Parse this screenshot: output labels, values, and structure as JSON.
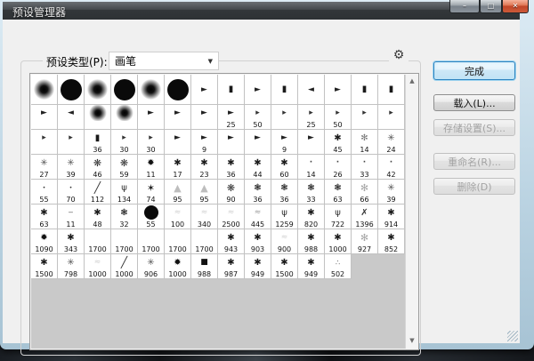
{
  "window": {
    "title": "预设管理器",
    "minimize_glyph": "–",
    "restore_glyph": "□",
    "close_glyph": "✕"
  },
  "toolbar": {
    "preset_type_label": "预设类型(P):",
    "preset_type_value": "画笔",
    "combo_arrow": "▼",
    "gear_icon": "⚙"
  },
  "scrollbar": {
    "up": "▲",
    "down": "▼"
  },
  "actions": [
    {
      "label": "完成",
      "enabled": true,
      "default": true
    },
    {
      "label": "载入(L)...",
      "enabled": true,
      "default": false
    },
    {
      "label": "存储设置(S)...",
      "enabled": false,
      "default": false
    },
    {
      "label": "重命名(R)...",
      "enabled": false,
      "default": false
    },
    {
      "label": "删除(D)",
      "enabled": false,
      "default": false
    }
  ],
  "colors": {
    "titlebar": "#3a3e41",
    "dialog_body": "#f0f0f0",
    "default_button_border": "#2f84c0",
    "close_button": "#c04527",
    "grid_empty": "#c9c9c9"
  },
  "glyphs": {
    "tip": "►",
    "arrow": "▸",
    "block": "▮",
    "block2": "■",
    "fan": "◄",
    "dot": "•",
    "tinydot": "·",
    "slash": "╱",
    "grass": "ψ",
    "star": "✶",
    "tri": "▲",
    "ast": "✳",
    "flake": "❋",
    "sparse": "✻",
    "fuzz": "✻",
    "spl": "✱",
    "leafd": "❃",
    "blob": "✹",
    "dash": "‒",
    "faint": "≈",
    "scrib": "≈",
    "zig": "✗",
    "tinytxt": "∴",
    "blank": "",
    "soft": "",
    "soft2": "",
    "hard": "",
    "hard2": ""
  },
  "grid": {
    "rows": [
      [
        [
          "soft",
          ""
        ],
        [
          "hard",
          ""
        ],
        [
          "soft",
          ""
        ],
        [
          "hard",
          ""
        ],
        [
          "soft",
          ""
        ],
        [
          "hard",
          ""
        ],
        [
          "tip",
          ""
        ],
        [
          "block",
          ""
        ],
        [
          "tip",
          ""
        ],
        [
          "block",
          ""
        ],
        [
          "fan",
          ""
        ],
        [
          "tip",
          ""
        ],
        [
          "block",
          ""
        ],
        [
          "block",
          ""
        ]
      ],
      [
        [
          "tip",
          ""
        ],
        [
          "fan",
          ""
        ],
        [
          "soft2",
          ""
        ],
        [
          "soft2",
          ""
        ],
        [
          "tip",
          ""
        ],
        [
          "tip",
          ""
        ],
        [
          "tip",
          ""
        ],
        [
          "tip",
          "25"
        ],
        [
          "arrow",
          "50"
        ],
        [
          "arrow",
          ""
        ],
        [
          "arrow",
          "25"
        ],
        [
          "arrow",
          "50"
        ],
        [
          "arrow",
          ""
        ],
        [
          "arrow",
          ""
        ]
      ],
      [
        [
          "arrow",
          ""
        ],
        [
          "arrow",
          ""
        ],
        [
          "block",
          "36"
        ],
        [
          "arrow",
          "30"
        ],
        [
          "arrow",
          "30"
        ],
        [
          "tip",
          ""
        ],
        [
          "tip",
          "9"
        ],
        [
          "tip",
          ""
        ],
        [
          "tip",
          ""
        ],
        [
          "tip",
          "9"
        ],
        [
          "tip",
          ""
        ],
        [
          "spl",
          "45"
        ],
        [
          "sparse",
          "14"
        ],
        [
          "ast",
          "24"
        ]
      ],
      [
        [
          "ast",
          "27"
        ],
        [
          "ast",
          "39"
        ],
        [
          "flake",
          "46"
        ],
        [
          "flake",
          "59"
        ],
        [
          "blob",
          "11"
        ],
        [
          "spl",
          "17"
        ],
        [
          "spl",
          "23"
        ],
        [
          "spl",
          "36"
        ],
        [
          "spl",
          "44"
        ],
        [
          "spl",
          "60"
        ],
        [
          "tinydot",
          "14"
        ],
        [
          "tinydot",
          "26"
        ],
        [
          "tinydot",
          "33"
        ],
        [
          "tinydot",
          "42"
        ]
      ],
      [
        [
          "dot",
          "55"
        ],
        [
          "dot",
          "70"
        ],
        [
          "slash",
          "112"
        ],
        [
          "grass",
          "134"
        ],
        [
          "star",
          "74"
        ],
        [
          "tri",
          "95"
        ],
        [
          "tri",
          "95"
        ],
        [
          "flake",
          "90"
        ],
        [
          "leafd",
          "36"
        ],
        [
          "leafd",
          "36"
        ],
        [
          "leafd",
          "33"
        ],
        [
          "leafd",
          "63"
        ],
        [
          "fuzz",
          "66"
        ],
        [
          "ast",
          "39"
        ]
      ],
      [
        [
          "spl",
          "63"
        ],
        [
          "dash",
          "11"
        ],
        [
          "spl",
          "48"
        ],
        [
          "leafd",
          "32"
        ],
        [
          "hard2",
          "55"
        ],
        [
          "faint",
          "100"
        ],
        [
          "faint",
          "340"
        ],
        [
          "faint",
          "2500"
        ],
        [
          "scrib",
          "445"
        ],
        [
          "grass",
          "1259"
        ],
        [
          "spl",
          "820"
        ],
        [
          "grass",
          "722"
        ],
        [
          "zig",
          "1396"
        ],
        [
          "spl",
          "914"
        ]
      ],
      [
        [
          "blob",
          "1090"
        ],
        [
          "spl",
          "343"
        ],
        [
          "blank",
          "1700"
        ],
        [
          "blank",
          "1700"
        ],
        [
          "blank",
          "1700"
        ],
        [
          "blank",
          "1700"
        ],
        [
          "blank",
          "1700"
        ],
        [
          "spl",
          "943"
        ],
        [
          "spl",
          "903"
        ],
        [
          "faint",
          "900"
        ],
        [
          "spl",
          "988"
        ],
        [
          "spl",
          "1000"
        ],
        [
          "fuzz",
          "927"
        ],
        [
          "spl",
          "852"
        ]
      ],
      [
        [
          "spl",
          "1500"
        ],
        [
          "ast",
          "798"
        ],
        [
          "faint",
          "1000"
        ],
        [
          "slash",
          "1000"
        ],
        [
          "ast",
          "906"
        ],
        [
          "blob",
          "1000"
        ],
        [
          "block2",
          "988"
        ],
        [
          "spl",
          "987"
        ],
        [
          "spl",
          "949"
        ],
        [
          "spl",
          "1500"
        ],
        [
          "spl",
          "949"
        ],
        [
          "tinytxt",
          "502"
        ]
      ]
    ]
  }
}
